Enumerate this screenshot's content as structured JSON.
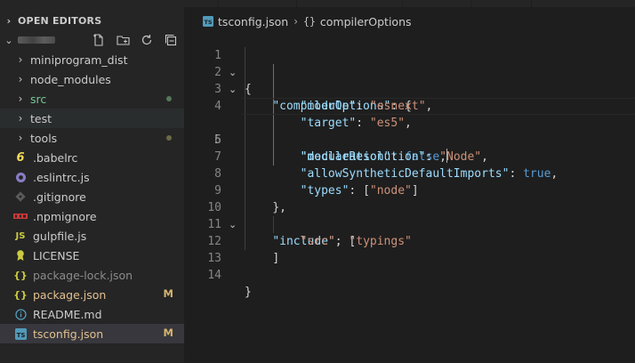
{
  "sidebar": {
    "open_editors_label": "OPEN EDITORS",
    "tree": [
      {
        "type": "folder",
        "label": "miniprogram_dist",
        "icon": "chevron-right-icon"
      },
      {
        "type": "folder",
        "label": "node_modules",
        "icon": "chevron-right-icon"
      },
      {
        "type": "folder",
        "label": "src",
        "icon": "chevron-right-icon",
        "status": "dot-green",
        "color": "#73c991"
      },
      {
        "type": "folder",
        "label": "test",
        "icon": "chevron-right-icon",
        "selected": true
      },
      {
        "type": "folder",
        "label": "tools",
        "icon": "chevron-right-icon",
        "status": "dot"
      },
      {
        "type": "file",
        "label": ".babelrc",
        "icon": "babel-icon"
      },
      {
        "type": "file",
        "label": ".eslintrc.js",
        "icon": "eslint-icon"
      },
      {
        "type": "file",
        "label": ".gitignore",
        "icon": "git-icon"
      },
      {
        "type": "file",
        "label": ".npmignore",
        "icon": "npm-icon"
      },
      {
        "type": "file",
        "label": "gulpfile.js",
        "icon": "js-icon"
      },
      {
        "type": "file",
        "label": "LICENSE",
        "icon": "license-icon"
      },
      {
        "type": "file",
        "label": "package-lock.json",
        "icon": "json-icon",
        "dimmed": true
      },
      {
        "type": "file",
        "label": "package.json",
        "icon": "json-icon",
        "badge": "M",
        "color": "#e2c08d"
      },
      {
        "type": "file",
        "label": "README.md",
        "icon": "info-icon"
      },
      {
        "type": "file",
        "label": "tsconfig.json",
        "icon": "ts-icon",
        "badge": "M",
        "color": "#e2c08d",
        "selected": true
      }
    ]
  },
  "editor": {
    "breadcrumb": {
      "file_icon_text": "TS",
      "file": "tsconfig.json",
      "symbol_icon": "{}",
      "symbol": "compilerOptions"
    },
    "current_line": 5,
    "lines": [
      {
        "n": "1",
        "fold": "⌄"
      },
      {
        "n": "2",
        "fold": "⌄"
      },
      {
        "n": "3",
        "fold": ""
      },
      {
        "n": "4",
        "fold": ""
      },
      {
        "n": "5",
        "fold": ""
      },
      {
        "n": "6",
        "fold": ""
      },
      {
        "n": "7",
        "fold": ""
      },
      {
        "n": "8",
        "fold": ""
      },
      {
        "n": "9",
        "fold": ""
      },
      {
        "n": "10",
        "fold": "⌄"
      },
      {
        "n": "11",
        "fold": ""
      },
      {
        "n": "12",
        "fold": ""
      },
      {
        "n": "13",
        "fold": ""
      },
      {
        "n": "14",
        "fold": ""
      }
    ],
    "code": {
      "l1": "{",
      "l2_key": "\"compilerOptions\"",
      "l2_rest": ": {",
      "l3_key": "\"module\"",
      "l3_sep": ": ",
      "l3_val": "\"esnext\"",
      "l3_end": ",",
      "l4_key": "\"target\"",
      "l4_sep": ": ",
      "l4_val": "\"es5\"",
      "l4_end": ",",
      "l5_key": "\"declaration\"",
      "l5_sep": ": ",
      "l5_val": "false",
      "l5_end": ",",
      "l6_key": "\"moduleResolution\"",
      "l6_sep": ": ",
      "l6_val": "\"Node\"",
      "l6_end": ",",
      "l7_key": "\"allowSyntheticDefaultImports\"",
      "l7_sep": ": ",
      "l7_val": "true",
      "l7_end": ",",
      "l8_key": "\"types\"",
      "l8_sep": ": [",
      "l8_val": "\"node\"",
      "l8_end": "]",
      "l9": "},",
      "l10_key": "\"include\"",
      "l10_rest": ": [",
      "l11_a": "\"src\"",
      "l11_sep": ", ",
      "l11_b": "\"typings\"",
      "l12": "]",
      "l13": "",
      "l14": "}"
    }
  }
}
